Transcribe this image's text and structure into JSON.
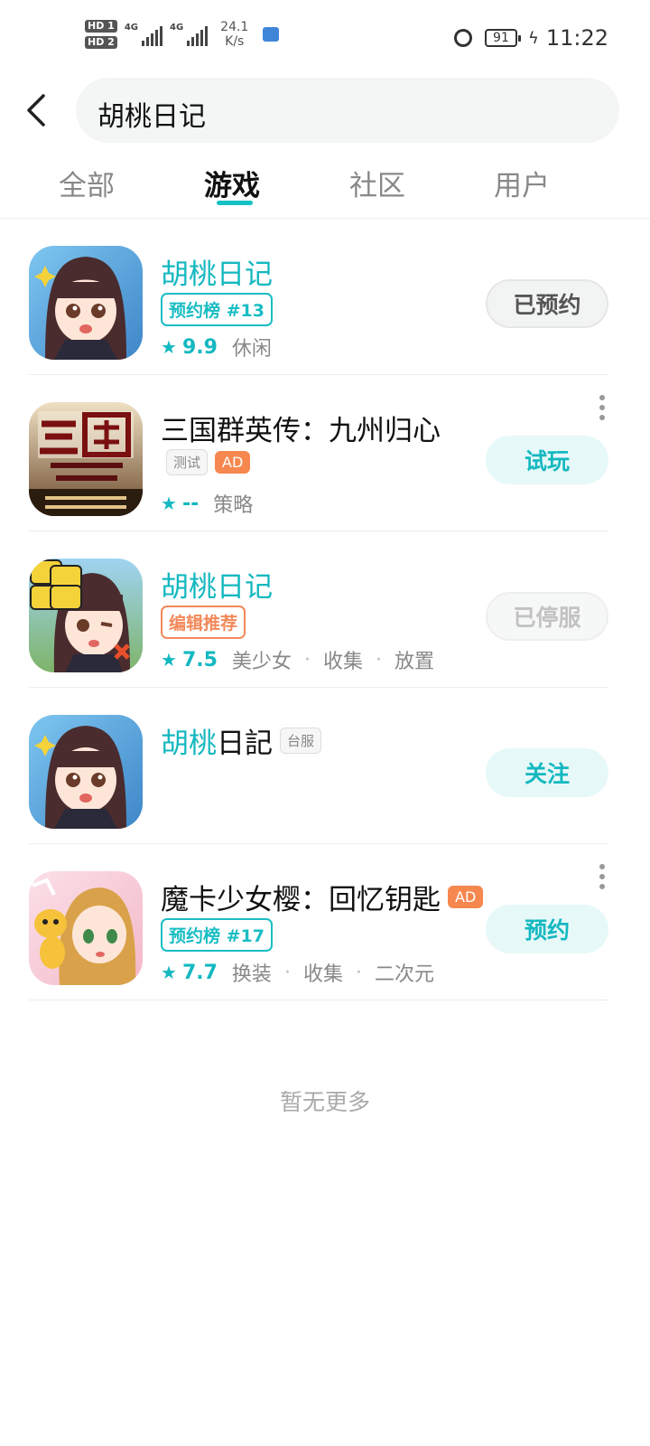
{
  "status_bar": {
    "hd1": "HD 1",
    "hd2": "HD 2",
    "net1": "4G",
    "net2": "4G",
    "speed_value": "24.1",
    "speed_unit": "K/s",
    "battery": "91",
    "time": "11:22"
  },
  "header": {
    "search_text": "胡桃日记"
  },
  "tabs": [
    "全部",
    "游戏",
    "社区",
    "用户"
  ],
  "active_tab_index": 1,
  "colors": {
    "accent": "#14b8c0",
    "ad": "#f6874f",
    "editor": "#f2895a"
  },
  "results": [
    {
      "title_highlight": "胡桃日记",
      "title_plain": "",
      "badge": "预约榜 #13",
      "rating": "9.9",
      "tags": [
        "休闲"
      ],
      "button": "已预约"
    },
    {
      "title_highlight": "",
      "title_plain": "三国群英传：九州归心",
      "test_tag": "测试",
      "ad": "AD",
      "rating": "--",
      "tags": [
        "策略"
      ],
      "button": "试玩"
    },
    {
      "title_highlight": "胡桃日记",
      "title_plain": "",
      "badge": "编辑推荐",
      "rating": "7.5",
      "tags": [
        "美少女",
        "收集",
        "放置"
      ],
      "button": "已停服"
    },
    {
      "title_highlight": "胡桃",
      "title_plain": "日記",
      "region_tag": "台服",
      "button": "关注"
    },
    {
      "title_highlight": "",
      "title_plain": "魔卡少女樱：回忆钥匙",
      "ad": "AD",
      "badge": "预约榜 #17",
      "rating": "7.7",
      "tags": [
        "换装",
        "收集",
        "二次元"
      ],
      "button": "预约"
    }
  ],
  "footer": {
    "no_more": "暂无更多"
  },
  "icons": {
    "back": "chevron-left-icon",
    "star": "star-icon",
    "more": "more-vertical-icon",
    "alarm": "alarm-icon"
  }
}
